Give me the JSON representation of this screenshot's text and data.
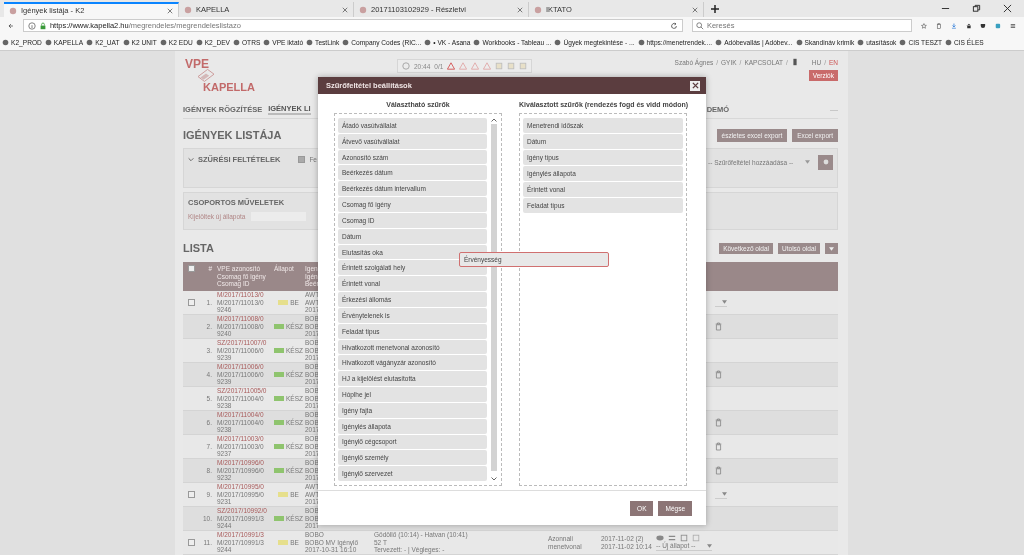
{
  "browser": {
    "tabs": [
      {
        "title": "Igények listája - K2",
        "selected": true
      },
      {
        "title": "KAPELLA",
        "selected": false
      },
      {
        "title": "20171103102929 - Részletvi",
        "selected": false
      },
      {
        "title": "IKTATO",
        "selected": false
      }
    ],
    "url_host": "https://www.kapella2.hu",
    "url_path": "/megrendeles/megrendeleslistazo",
    "search": {
      "placeholder": "Keresés"
    },
    "bookmarks": [
      "K2_PROD",
      "KAPELLA",
      "K2_UAT",
      "K2 UNIT",
      "K2 EDU",
      "K2_DEV",
      "OTRS",
      "VPE iktató",
      "TestLink",
      "Company Codes (RIC...",
      "• VK - Asana",
      "Workbooks - Tableau ...",
      "Ügyek megtekintése - ...",
      "https://menetrendek....",
      "Adóbevallás | Adóbev...",
      "Skandináv krimik",
      "utasítások",
      "CIS TESZT",
      "CIS ÉLES"
    ]
  },
  "app": {
    "logo": {
      "top": "VPE",
      "bottom": "KAPELLA"
    },
    "clock": "20:44",
    "counter": "0/1",
    "separator": "/",
    "user_links": [
      "Szabó Ágnes",
      "GYIK",
      "KAPCSOLAT"
    ],
    "languages": [
      {
        "label": "HU",
        "selected": false
      },
      {
        "label": "EN",
        "selected": true
      }
    ],
    "version_button": "Verziók",
    "nav": [
      {
        "label": "IGÉNYEK RÖGZÍTÉSE",
        "selected": false
      },
      {
        "label": "IGÉNYEK LI",
        "selected": true
      }
    ],
    "nav_right": "DEMÓ",
    "nav_more": "—",
    "page_title": "IGÉNYEK LISTÁJA",
    "export_buttons": [
      "észletes excel export",
      "Excel export"
    ],
    "filter_panel": {
      "title": "SZŰRÉSI FELTÉTELEK",
      "option": {
        "label": "Fe",
        "checked": true
      },
      "select_value": "-- Szűrőfeltétel hozzáadása --"
    },
    "bulk_panel": {
      "title": "CSOPORTOS MŰVELETEK",
      "label": "Kijelöltek új állapota"
    },
    "list_title": "LISTA",
    "pager": [
      "Következő oldal",
      "Utolsó oldal"
    ],
    "table": {
      "header_checkbox": {
        "checked": false
      },
      "columns": [
        "#",
        [
          "VPE azonosító",
          "Csomag fő igény",
          "Csomag ID"
        ],
        "Állapot",
        [
          "Igen",
          "Igén",
          "Beér"
        ]
      ],
      "rows": [
        {
          "checked": false,
          "number": "1.",
          "ids": [
            "M/2017/11013/0",
            "M/2017/11013/0",
            "9246"
          ],
          "status": {
            "label": "BE",
            "color": "#e6df8c"
          },
          "requester": [
            "AWT",
            "AWT",
            "2017"
          ],
          "kind": "select"
        },
        {
          "number": "2.",
          "ids": [
            "M/2017/11008/0",
            "M/2017/11008/0",
            "9240"
          ],
          "status": {
            "label": "KÉSZ",
            "color": "#8fc46e"
          },
          "requester": [
            "BOB",
            "BOB",
            "2017"
          ],
          "kind": "delete"
        },
        {
          "number": "3.",
          "ids": [
            "SZ/2017/11007/0",
            "M/2017/11006/0",
            "9239"
          ],
          "status": {
            "label": "KÉSZ",
            "color": "#8fc46e"
          },
          "requester": [
            "BOB",
            "BOB",
            "2017"
          ]
        },
        {
          "number": "4.",
          "ids": [
            "M/2017/11006/0",
            "M/2017/11006/0",
            "9239"
          ],
          "status": {
            "label": "KÉSZ",
            "color": "#8fc46e"
          },
          "requester": [
            "BOB",
            "BOB",
            "2017"
          ],
          "kind": "delete"
        },
        {
          "number": "5.",
          "ids": [
            "SZ/2017/11005/0",
            "M/2017/11004/0",
            "9238"
          ],
          "status": {
            "label": "KÉSZ",
            "color": "#8fc46e"
          },
          "requester": [
            "BOB",
            "BOB",
            "2017"
          ]
        },
        {
          "number": "6.",
          "ids": [
            "M/2017/11004/0",
            "M/2017/11004/0",
            "9238"
          ],
          "status": {
            "label": "KÉSZ",
            "color": "#8fc46e"
          },
          "requester": [
            "BOB",
            "BOB",
            "2017"
          ],
          "kind": "delete"
        },
        {
          "number": "7.",
          "ids": [
            "M/2017/11003/0",
            "M/2017/11003/0",
            "9237"
          ],
          "status": {
            "label": "KÉSZ",
            "color": "#8fc46e"
          },
          "requester": [
            "BOB",
            "BOB",
            "2017"
          ],
          "kind": "delete"
        },
        {
          "number": "8.",
          "ids": [
            "M/2017/10996/0",
            "M/2017/10996/0",
            "9232"
          ],
          "status": {
            "label": "KÉSZ",
            "color": "#8fc46e"
          },
          "requester": [
            "BOB",
            "BOB",
            "2017"
          ],
          "kind": "delete"
        },
        {
          "checked": false,
          "number": "9.",
          "ids": [
            "M/2017/10995/0",
            "M/2017/10995/0",
            "9231"
          ],
          "status": {
            "label": "BE",
            "color": "#e6df8c"
          },
          "requester": [
            "AWT",
            "AWT",
            "2017"
          ],
          "kind": "select"
        },
        {
          "number": "10.",
          "ids": [
            "SZ/2017/10992/0",
            "M/2017/10991/3",
            "9244"
          ],
          "status": {
            "label": "KÉSZ",
            "color": "#8fc46e"
          },
          "requester": [
            "BOB",
            "BOB",
            "2017"
          ]
        },
        {
          "checked": false,
          "number": "11.",
          "ids": [
            "M/2017/10991/3",
            "M/2017/10991/3",
            "9244"
          ],
          "status": {
            "label": "BE",
            "color": "#e6df8c"
          },
          "kind": "select",
          "select_value": "-- Új állapot --",
          "details": {
            "requester": [
              "BOBO",
              "BOBO MV Igénylő",
              "2017-10-31 16:10"
            ],
            "route": [
              "Gödöllő (10:14) - Hatvan (10:41)",
              "52 T",
              "Tervezett: - | Végleges: -"
            ],
            "type": [
              "Azonnali",
              "menetvonal"
            ],
            "dates": [
              "2017-11-02 (2)",
              "2017-11-02 10:14"
            ]
          }
        }
      ]
    }
  },
  "dialog": {
    "title": "Szűrőfeltétel beállítások",
    "available": {
      "heading": "Választható szűrők",
      "items": [
        "Átadó vasútvállalat",
        "Átvevő vasútvállalat",
        "Azonosító szám",
        "Beérkezés dátum",
        "Beérkezés dátum intervallum",
        "Csomag fő igény",
        "Csomag ID",
        "Dátum",
        "Elutasítás oka",
        "Érintett szolgálati hely",
        "Érintett vonal",
        "Érkezési állomás",
        "Érvénytelenek is",
        "Feladat típus",
        "Hivatkozott menetvonal azonosító",
        "Hivatkozott vágányzár azonosító",
        "HJ a kijelölést elutasította",
        "Hóplhe jel",
        "Igény fajta",
        "Igénylés állapota",
        "Igénylő cégcsoport",
        "Igénylő személy",
        "Igénylő szervezet"
      ]
    },
    "chosen": {
      "heading": "Kiválasztott szűrők (rendezés fogd és vidd módon)",
      "items": [
        "Menetrendi időszak",
        "Dátum",
        "Igény típus",
        "Igénylés állapota",
        "Érintett vonal",
        "Feladat típus"
      ]
    },
    "dragged_item": "Érvényesség",
    "buttons": [
      "OK",
      "Mégse"
    ]
  }
}
